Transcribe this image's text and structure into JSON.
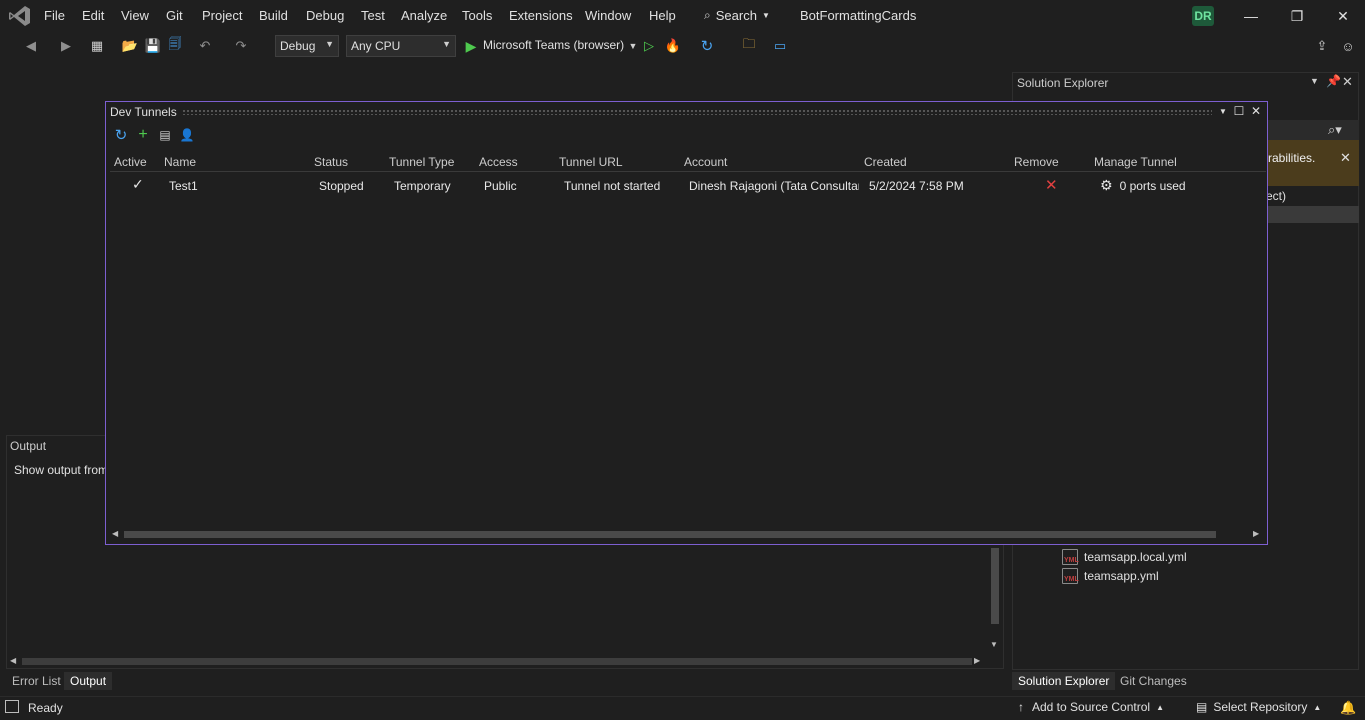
{
  "menu": {
    "items": [
      "File",
      "Edit",
      "View",
      "Git",
      "Project",
      "Build",
      "Debug",
      "Test",
      "Analyze",
      "Tools",
      "Extensions",
      "Window",
      "Help"
    ],
    "search_label": "Search",
    "solution_name": "BotFormattingCards",
    "avatar_initials": "DR"
  },
  "toolbar": {
    "config": "Debug",
    "platform": "Any CPU",
    "run_target": "Microsoft Teams (browser)"
  },
  "dev_tunnels": {
    "title": "Dev Tunnels",
    "columns": [
      "Active",
      "Name",
      "Status",
      "Tunnel Type",
      "Access",
      "Tunnel URL",
      "Account",
      "Created",
      "Remove",
      "Manage Tunnel"
    ],
    "rows": [
      {
        "active": "✓",
        "name": "Test1",
        "status": "Stopped",
        "tunnel_type": "Temporary",
        "access": "Public",
        "tunnel_url": "Tunnel not started",
        "account": "Dinesh Rajagoni (Tata Consultar",
        "created": "5/2/2024 7:58 PM",
        "remove": "✕",
        "manage": "0 ports used"
      }
    ]
  },
  "solution_explorer": {
    "title": "Solution Explorer",
    "warning_text": "rabilities.",
    "partial_text": "ect)",
    "files": [
      "teamsapp.local.yml",
      "teamsapp.yml"
    ],
    "tabs": [
      "Solution Explorer",
      "Git Changes"
    ]
  },
  "output": {
    "title": "Output",
    "show_output_from": "Show output from",
    "tabs": [
      "Error List",
      "Output"
    ]
  },
  "statusbar": {
    "ready": "Ready",
    "add_source": "Add to Source Control",
    "select_repo": "Select Repository"
  },
  "colors": {
    "background": "#1f1f1f",
    "dialog_border": "#7d5fd1",
    "accent_blue": "#4aa3f0",
    "run_green": "#4ec94e",
    "remove_red": "#e04040"
  }
}
